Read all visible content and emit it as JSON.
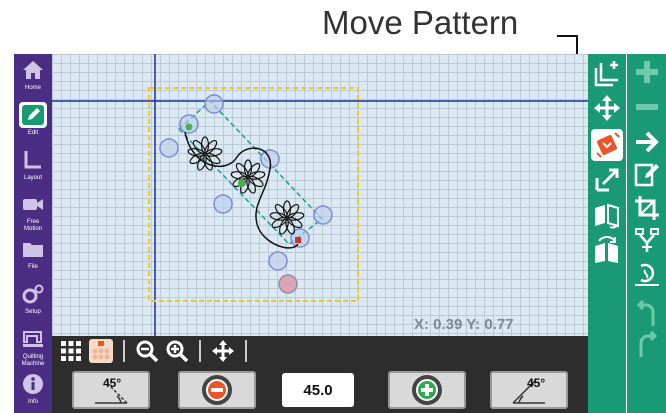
{
  "callout": {
    "label": "Move Pattern"
  },
  "left_nav": {
    "items": [
      {
        "id": "home",
        "label": "Home",
        "active": false
      },
      {
        "id": "edit",
        "label": "Edit",
        "active": true
      },
      {
        "id": "layout",
        "label": "Layout",
        "active": false
      },
      {
        "id": "free_motion",
        "label": "Free\nMotion",
        "active": false
      },
      {
        "id": "file",
        "label": "File",
        "active": false
      },
      {
        "id": "setup",
        "label": "Setup",
        "active": false
      },
      {
        "id": "quilting_machine",
        "label": "Quilting\nMachine",
        "active": false
      },
      {
        "id": "info",
        "label": "Info",
        "active": false
      }
    ]
  },
  "canvas": {
    "coords_readout": "X:  0.39 Y:  0.77"
  },
  "toolbar": {
    "angle_value": "45.0",
    "rotate_ccw_label": "45°",
    "rotate_cw_label": "45°"
  },
  "colors": {
    "nav_purple": "#4b2e83",
    "panel_green": "#1a9a74",
    "active_orange": "#e8562a",
    "selection_yellow": "#f2c811"
  },
  "icons": {
    "right_panel_1": [
      "add-pattern-icon",
      "move-icon",
      "move-pattern-icon",
      "resize-icon",
      "mirror-icon",
      "rotate-icon"
    ],
    "right_panel_2": [
      "plus-icon",
      "minus-icon",
      "arrow-right-icon",
      "edit-pattern-icon",
      "crop-icon",
      "merge-icon",
      "repeat-icon",
      "undo-icon",
      "redo-icon"
    ]
  }
}
